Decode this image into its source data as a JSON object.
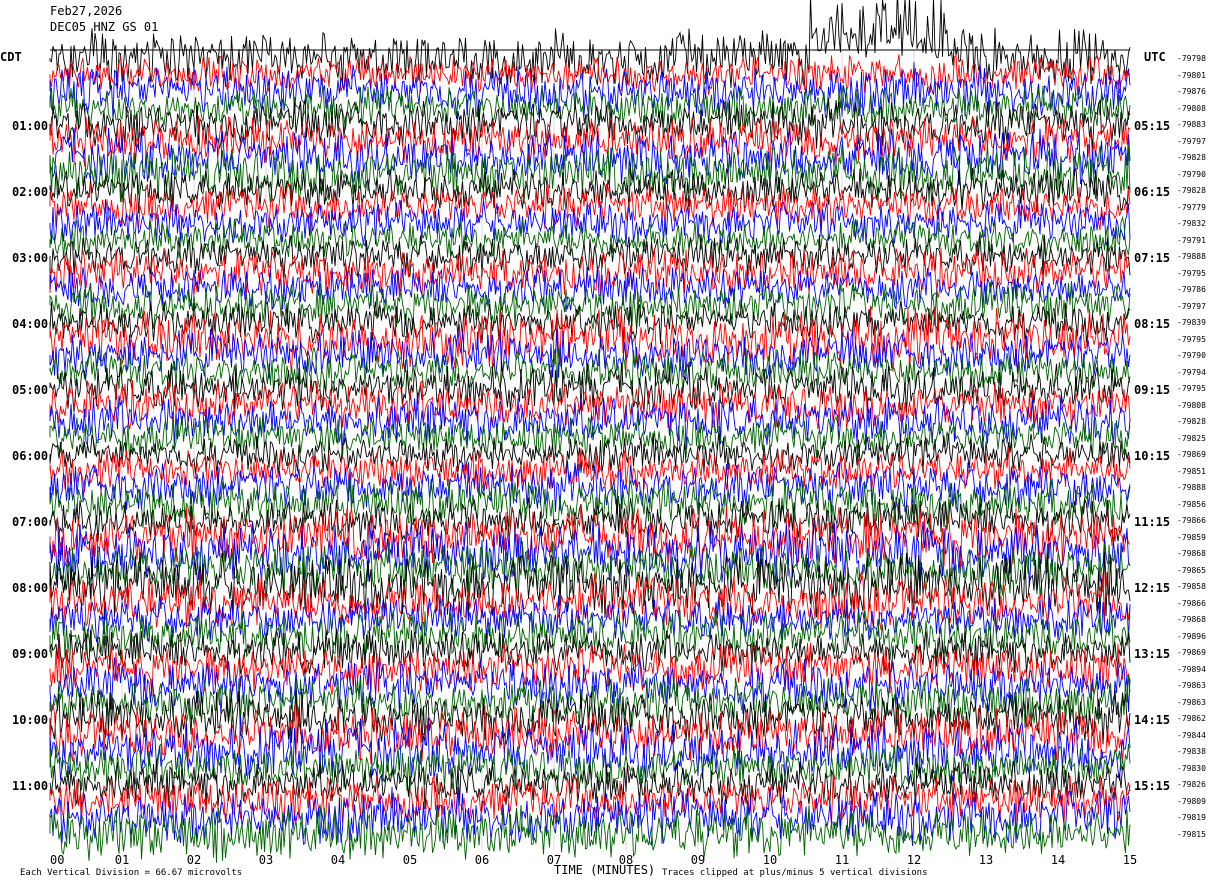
{
  "header": {
    "date": "Feb27,2026",
    "station": "DEC05 HNZ GS 01"
  },
  "left_axis_label": "CDT",
  "right_axis_label": "UTC",
  "footer": {
    "scale_note": "Each Vertical Division =   66.67 microvolts",
    "clip_note": "Traces clipped at plus/minus 5 vertical divisions"
  },
  "trace_colors": [
    "#000000",
    "#ff0000",
    "#0000ff",
    "#006400"
  ],
  "chart_data": {
    "type": "line",
    "title": "",
    "xlabel": "TIME (MINUTES)",
    "ylabel": "",
    "xlim": [
      0,
      15
    ],
    "x_ticks": [
      "00",
      "01",
      "02",
      "03",
      "04",
      "05",
      "06",
      "07",
      "08",
      "09",
      "10",
      "11",
      "12",
      "13",
      "14",
      "15"
    ],
    "rows": 48,
    "minutes_per_row": 15,
    "left_hour_labels": [
      "01:00",
      "02:00",
      "03:00",
      "04:00",
      "05:00",
      "06:00",
      "07:00",
      "08:00",
      "09:00",
      "10:00",
      "11:00"
    ],
    "right_hour_labels": [
      "05:15",
      "06:15",
      "07:15",
      "08:15",
      "09:15",
      "10:15",
      "11:15",
      "12:15",
      "13:15",
      "14:15",
      "15:15"
    ],
    "row_values": [
      -79798,
      -79801,
      -79876,
      -79808,
      -79883,
      -79797,
      -79828,
      -79790,
      -79828,
      -79779,
      -79832,
      -79791,
      -79888,
      -79795,
      -79786,
      -79797,
      -79839,
      -79795,
      -79790,
      -79794,
      -79795,
      -79808,
      -79828,
      -79825,
      -79869,
      -79851,
      -79888,
      -79856,
      -79866,
      -79859,
      -79868,
      -79865,
      -79858,
      -79866,
      -79868,
      -79896,
      -79869,
      -79894,
      -79863,
      -79863,
      -79862,
      -79844,
      -79838,
      -79830,
      -79826,
      -79809,
      -79819,
      -79815
    ]
  }
}
